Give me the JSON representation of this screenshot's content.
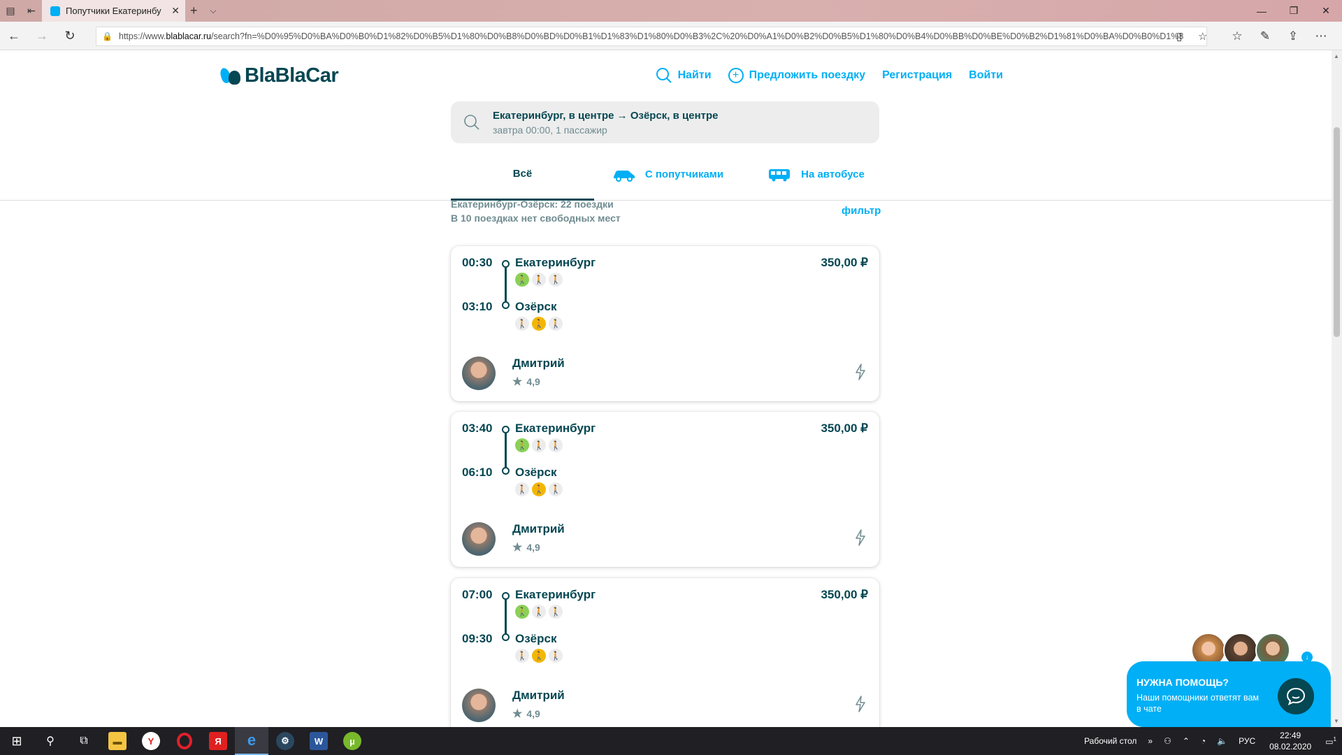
{
  "browser": {
    "tab_title": "Попутчики Екатеринбу",
    "url_prefix": "https://www.",
    "url_domain": "blablacar.ru",
    "url_rest": "/search?fn=%D0%95%D0%BA%D0%B0%D1%82%D0%B5%D1%80%D0%B8%D0%BD%D0%B1%D1%83%D1%80%D0%B3%2C%20%D0%A1%D0%B2%D0%B5%D1%80%D0%B4%D0%BB%D0%BE%D0%B2%D1%81%D0%BA%D0%B0%D1%8"
  },
  "site": {
    "logo_text": "BlaBlaCar",
    "nav": {
      "find": "Найти",
      "offer": "Предложить поездку",
      "register": "Регистрация",
      "login": "Войти"
    }
  },
  "search": {
    "route": "Екатеринбург, в центре → Озёрск, в центре",
    "details": "завтра 00:00, 1 пассажир"
  },
  "tabs": {
    "all": "Всё",
    "carpool": "С попутчиками",
    "bus": "На автобусе"
  },
  "results": {
    "summary": "Екатеринбург-Озёрск: 22 поездки",
    "full_note": "В 10 поездках нет свободных мест",
    "filter_label": "фильтр"
  },
  "trips": [
    {
      "depart": "00:30",
      "arrive": "03:10",
      "from": "Екатеринбург",
      "to": "Озёрск",
      "price": "350,00 ₽",
      "driver": "Дмитрий",
      "rating": "4,9"
    },
    {
      "depart": "03:40",
      "arrive": "06:10",
      "from": "Екатеринбург",
      "to": "Озёрск",
      "price": "350,00 ₽",
      "driver": "Дмитрий",
      "rating": "4,9"
    },
    {
      "depart": "07:00",
      "arrive": "09:30",
      "from": "Екатеринбург",
      "to": "Озёрск",
      "price": "350,00 ₽",
      "driver": "Дмитрий",
      "rating": "4,9"
    }
  ],
  "help": {
    "title": "НУЖНА ПОМОЩЬ?",
    "text": "Наши помощники ответят вам в чате"
  },
  "taskbar": {
    "desktop_label": "Рабочий стол",
    "lang": "РУС",
    "time": "22:49",
    "date": "08.02.2020",
    "notif_count": "1"
  },
  "colors": {
    "brand_blue": "#00aff5",
    "brand_dark": "#054752",
    "muted": "#708c91"
  }
}
